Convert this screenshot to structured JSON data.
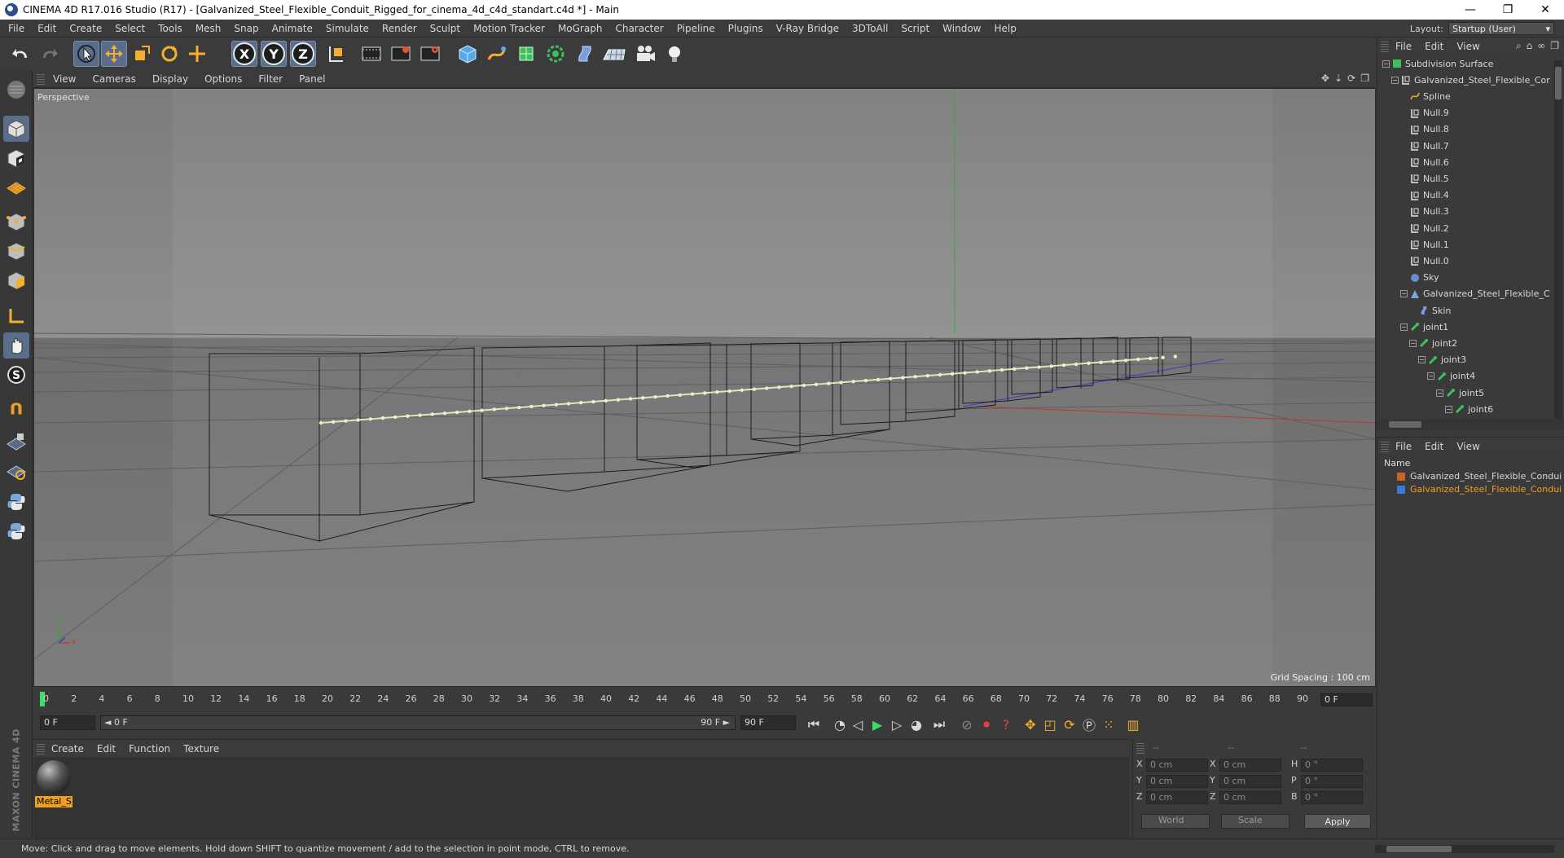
{
  "window": {
    "title": "CINEMA 4D R17.016 Studio (R17) - [Galvanized_Steel_Flexible_Conduit_Rigged_for_cinema_4d_c4d_standart.c4d *] - Main",
    "minimize": "—",
    "restore": "❐",
    "close": "✕"
  },
  "menubar": {
    "items": [
      "File",
      "Edit",
      "Create",
      "Select",
      "Tools",
      "Mesh",
      "Snap",
      "Animate",
      "Simulate",
      "Render",
      "Sculpt",
      "Motion Tracker",
      "MoGraph",
      "Character",
      "Pipeline",
      "Plugins",
      "V-Ray Bridge",
      "3DToAll",
      "Script",
      "Window",
      "Help"
    ],
    "layout_label": "Layout:",
    "layout_value": "Startup (User)"
  },
  "toolbar": {
    "icons": [
      "undo-icon",
      "redo-icon",
      "live-selection-icon",
      "move-icon",
      "scale-icon",
      "rotate-icon",
      "recent-tools-icon",
      "x-axis-lock-icon",
      "y-axis-lock-icon",
      "z-axis-lock-icon",
      "coordinate-system-icon",
      "render-view-icon",
      "render-picture-viewer-icon",
      "render-settings-icon",
      "cube-primitive-icon",
      "pen-spline-icon",
      "subdivision-surface-icon",
      "array-cloner-icon",
      "deformer-icon",
      "floor-environment-icon",
      "camera-icon",
      "light-icon"
    ],
    "axis_x": "X",
    "axis_y": "Y",
    "axis_z": "Z"
  },
  "leftbar": {
    "icons": [
      "make-editable-icon",
      "model-mode-icon",
      "texture-mode-icon",
      "workplane-icon",
      "points-mode-icon",
      "edges-mode-icon",
      "polygons-mode-icon",
      "axis-mode-icon",
      "tweak-mode-icon",
      "solo-mode-icon",
      "snap-icon",
      "workplane-lock-icon",
      "workplane-rotate-icon",
      "python-icon",
      "python-script-icon"
    ]
  },
  "viewport": {
    "menu": [
      "View",
      "Cameras",
      "Display",
      "Options",
      "Filter",
      "Panel"
    ],
    "camera_label": "Perspective",
    "grid_spacing": "Grid Spacing : 100 cm",
    "axis_y_label": "y",
    "axis_x_label": "x"
  },
  "timeline": {
    "ticks": [
      "0",
      "2",
      "4",
      "6",
      "8",
      "10",
      "12",
      "14",
      "16",
      "18",
      "20",
      "22",
      "24",
      "26",
      "28",
      "30",
      "32",
      "34",
      "36",
      "38",
      "40",
      "42",
      "44",
      "46",
      "48",
      "50",
      "52",
      "54",
      "56",
      "58",
      "60",
      "62",
      "64",
      "66",
      "68",
      "70",
      "72",
      "74",
      "76",
      "78",
      "80",
      "82",
      "84",
      "86",
      "88",
      "90"
    ],
    "current_frame": "0 F"
  },
  "transport": {
    "start_field": "0 F",
    "range_start": "◄ 0 F",
    "range_end": "90 F ►",
    "end_field": "90 F"
  },
  "material_manager": {
    "menu": [
      "Create",
      "Edit",
      "Function",
      "Texture"
    ],
    "material_name": "Metal_S"
  },
  "maxon_logo": "MAXON CINEMA 4D",
  "coordinates": {
    "headers": [
      "--",
      "--",
      "--"
    ],
    "rows": [
      {
        "l1": "X",
        "v1": "0 cm",
        "l2": "X",
        "v2": "0 cm",
        "l3": "H",
        "v3": "0 °"
      },
      {
        "l1": "Y",
        "v1": "0 cm",
        "l2": "Y",
        "v2": "0 cm",
        "l3": "P",
        "v3": "0 °"
      },
      {
        "l1": "Z",
        "v1": "0 cm",
        "l2": "Z",
        "v2": "0 cm",
        "l3": "B",
        "v3": "0 °"
      }
    ],
    "world": "World",
    "scale": "Scale",
    "apply": "Apply"
  },
  "object_manager": {
    "menu": [
      "File",
      "Edit",
      "View"
    ],
    "objects": [
      {
        "name": "Subdivision Surface",
        "indent": 0,
        "icon": "subdivision-icon",
        "expanded": true
      },
      {
        "name": "Galvanized_Steel_Flexible_Cor",
        "indent": 1,
        "icon": "null-icon",
        "expanded": true
      },
      {
        "name": "Spline",
        "indent": 2,
        "icon": "spline-icon"
      },
      {
        "name": "Null.9",
        "indent": 2,
        "icon": "null-icon"
      },
      {
        "name": "Null.8",
        "indent": 2,
        "icon": "null-icon"
      },
      {
        "name": "Null.7",
        "indent": 2,
        "icon": "null-icon"
      },
      {
        "name": "Null.6",
        "indent": 2,
        "icon": "null-icon"
      },
      {
        "name": "Null.5",
        "indent": 2,
        "icon": "null-icon"
      },
      {
        "name": "Null.4",
        "indent": 2,
        "icon": "null-icon"
      },
      {
        "name": "Null.3",
        "indent": 2,
        "icon": "null-icon"
      },
      {
        "name": "Null.2",
        "indent": 2,
        "icon": "null-icon"
      },
      {
        "name": "Null.1",
        "indent": 2,
        "icon": "null-icon"
      },
      {
        "name": "Null.0",
        "indent": 2,
        "icon": "null-icon"
      },
      {
        "name": "Sky",
        "indent": 2,
        "icon": "sky-icon"
      },
      {
        "name": "Galvanized_Steel_Flexible_C",
        "indent": 2,
        "icon": "mesh-icon",
        "expanded": true
      },
      {
        "name": "Skin",
        "indent": 3,
        "icon": "skin-icon"
      },
      {
        "name": "joint1",
        "indent": 2,
        "icon": "joint-icon",
        "expanded": true
      },
      {
        "name": "joint2",
        "indent": 3,
        "icon": "joint-icon",
        "expanded": true
      },
      {
        "name": "joint3",
        "indent": 4,
        "icon": "joint-icon",
        "expanded": true
      },
      {
        "name": "joint4",
        "indent": 5,
        "icon": "joint-icon",
        "expanded": true
      },
      {
        "name": "joint5",
        "indent": 6,
        "icon": "joint-icon",
        "expanded": true
      },
      {
        "name": "joint6",
        "indent": 7,
        "icon": "joint-icon",
        "expanded": true
      }
    ]
  },
  "layer_manager": {
    "menu": [
      "File",
      "Edit",
      "View"
    ],
    "header": "Name",
    "layers": [
      {
        "name": "Galvanized_Steel_Flexible_Condui",
        "color": "#c86428",
        "text_color": "#d8d8d8"
      },
      {
        "name": "Galvanized_Steel_Flexible_Condui",
        "color": "#3c78d8",
        "text_color": "#f0a020"
      }
    ]
  },
  "status": "Move: Click and drag to move elements. Hold down SHIFT to quantize movement / add to the selection in point mode, CTRL to remove.",
  "colors": {
    "accent_active": "#5a6e8c",
    "material_tag": "#f0a020",
    "playhead": "#3adf6a"
  }
}
